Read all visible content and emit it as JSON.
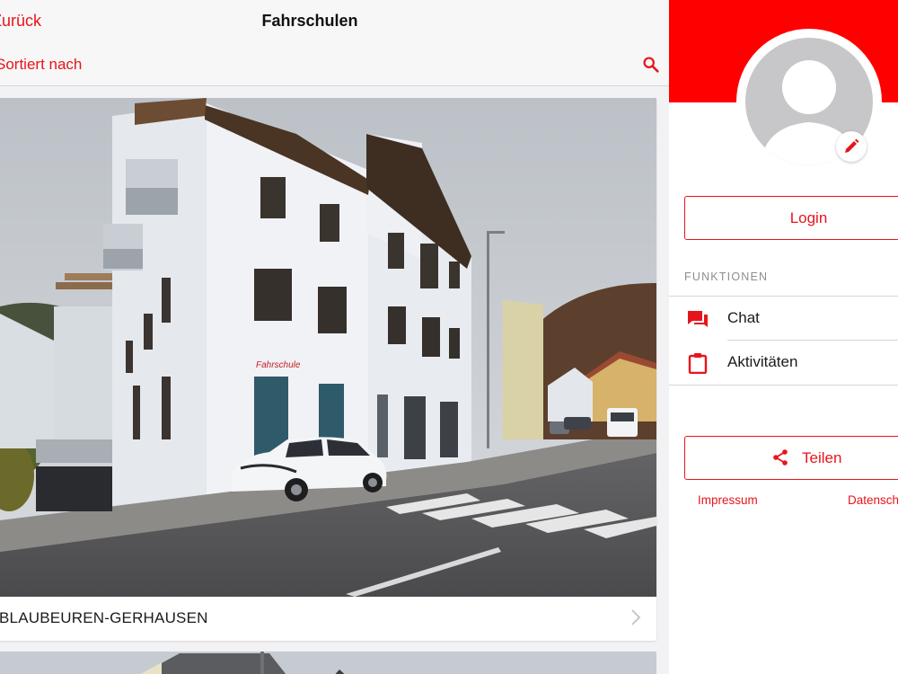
{
  "navbar": {
    "back_label": "Zurück",
    "title": "Fahrschulen"
  },
  "sortbar": {
    "sort_label": "Sortiert nach"
  },
  "list": {
    "items": [
      {
        "label": "BLAUBEUREN-GERHAUSEN"
      },
      {
        "label": ""
      }
    ]
  },
  "sidebar": {
    "login_label": "Login",
    "section_title": "FUNKTIONEN",
    "menu": [
      {
        "label": "Chat",
        "icon": "chat-icon"
      },
      {
        "label": "Aktivitäten",
        "icon": "clipboard-icon"
      }
    ],
    "share_label": "Teilen",
    "footer_links": [
      "Impressum",
      "Datenschutz"
    ]
  },
  "photo": {
    "sign_text": "Fahrschule"
  },
  "colors": {
    "accent": "#e8141b",
    "header_red": "#ff0000",
    "list_background": "#f2f2f4",
    "avatar_gray": "#c7c7c9"
  }
}
